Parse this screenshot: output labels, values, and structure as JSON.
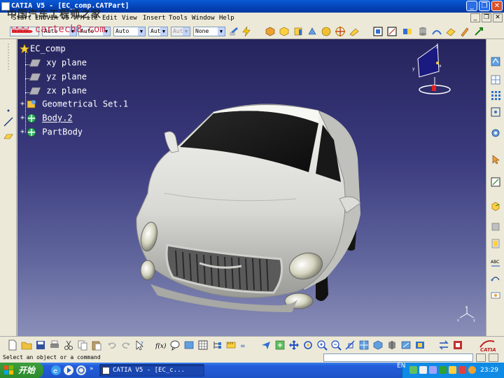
{
  "window": {
    "title": "CATIA V5 - [EC_comp.CATPart]",
    "controls": [
      "_",
      "❐",
      "✕"
    ]
  },
  "watermark": {
    "line1": "中国汽车工程师之家",
    "line2": "www.cartech8.com"
  },
  "menu": {
    "items": [
      "Start",
      "ENOVIA V5 VPM",
      "File",
      "Edit",
      "View",
      "Insert",
      "Tools",
      "Window",
      "Help"
    ]
  },
  "properties_toolbar": {
    "linetype": "Auto",
    "thickness": "Auto",
    "transparency": "Auto",
    "layer_auto": "Aut",
    "layer_disabled": "Aut",
    "layer": "None"
  },
  "tree": {
    "root": "EC_comp",
    "items": [
      {
        "label": "xy plane",
        "icon": "plane-icon"
      },
      {
        "label": "yz plane",
        "icon": "plane-icon"
      },
      {
        "label": "zx plane",
        "icon": "plane-icon"
      },
      {
        "label": "Geometrical Set.1",
        "icon": "geometrical-set-icon"
      },
      {
        "label": "Body.2",
        "icon": "body-icon"
      },
      {
        "label": "PartBody",
        "icon": "partbody-icon"
      }
    ]
  },
  "compass": {
    "axes": [
      "x",
      "y",
      "z"
    ]
  },
  "status": {
    "prompt": "Select an object or a command"
  },
  "taskbar": {
    "start_label": "开始",
    "task_label": "CATIA V5 - [EC_c...",
    "language": "EN",
    "clock": "23:29"
  },
  "colors": {
    "titlebar": "#0442b5",
    "viewport_top": "#26245c",
    "viewport_bottom": "#8a8fb8",
    "taskbar": "#245edb",
    "start_button": "#2b8a2b",
    "car_body": "#d8d8d4"
  },
  "icons": {
    "top_toolbar": [
      "paint-icon",
      "bolt-icon",
      "cube-orange-icon",
      "cube-yellow-icon",
      "cylinder-icon",
      "wireframe-icon",
      "cross-icon",
      "sketch-icon",
      "sketch-frame-icon",
      "measure-icon",
      "parts-icon",
      "sweep-icon",
      "surface-icon",
      "pencil-icon"
    ],
    "bottom_toolbar": [
      "new-icon",
      "open-icon",
      "save-icon",
      "print-icon",
      "cut-icon",
      "copy-icon",
      "paste-icon",
      "undo-icon",
      "redo-icon",
      "help-icon",
      "formula-icon",
      "comment-icon",
      "grid-icon",
      "tree-icon",
      "measure-icon",
      "fly-icon",
      "fit-all-icon",
      "pan-icon",
      "rotate-icon",
      "zoom-in-icon",
      "zoom-out-icon",
      "normal-view-icon",
      "iso-view-icon",
      "render-icon",
      "hide-icon",
      "swap-icon",
      "3dx-icon",
      "catia-logo-icon"
    ]
  }
}
